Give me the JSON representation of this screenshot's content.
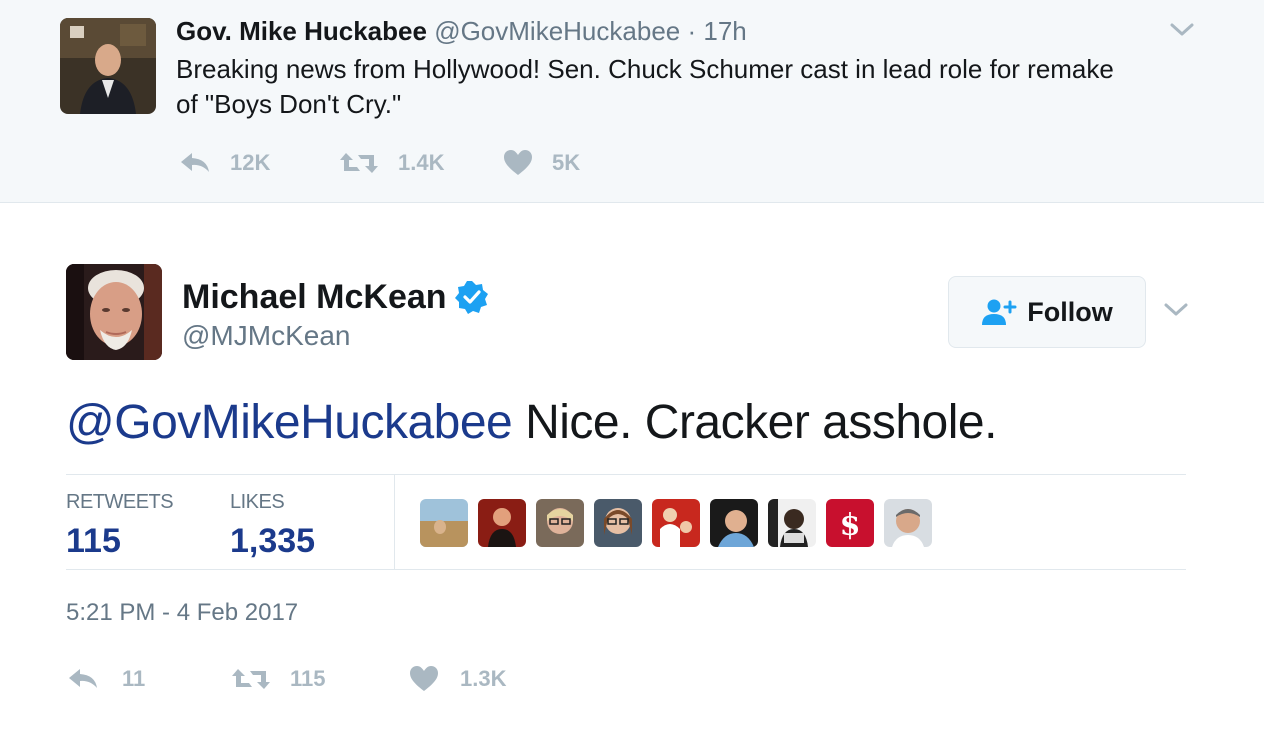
{
  "parent_tweet": {
    "display_name": "Gov. Mike Huckabee",
    "handle": "@GovMikeHuckabee",
    "separator": "·",
    "time": "17h",
    "text": "Breaking news from Hollywood!  Sen. Chuck Schumer cast in lead role for remake of \"Boys Don't Cry.\"",
    "avatar_icon": "avatar-photo",
    "caret_icon": "chevron-down-icon",
    "actions": {
      "reply_count": "12K",
      "retweet_count": "1.4K",
      "like_count": "5K"
    }
  },
  "tweet": {
    "display_name": "Michael McKean",
    "verified_icon": "verified-badge-icon",
    "handle": "@MJMcKean",
    "follow_label": "Follow",
    "follow_icon": "add-user-icon",
    "caret_icon": "chevron-down-icon",
    "mention": "@GovMikeHuckabee",
    "text_rest": " Nice. Cracker asshole.",
    "stats": {
      "retweets_label": "RETWEETS",
      "retweets_value": "115",
      "likes_label": "LIKES",
      "likes_value": "1,335"
    },
    "liker_avatars_count": 9,
    "timestamp": "5:21 PM - 4 Feb 2017",
    "actions": {
      "reply_count": "11",
      "retweet_count": "115",
      "like_count": "1.3K"
    }
  },
  "colors": {
    "accent_blue": "#1da1f2",
    "mention_blue": "#1b3a8c",
    "muted_gray": "#657786",
    "icon_gray": "#aab8c2",
    "parent_bg": "#f5f8fa"
  }
}
